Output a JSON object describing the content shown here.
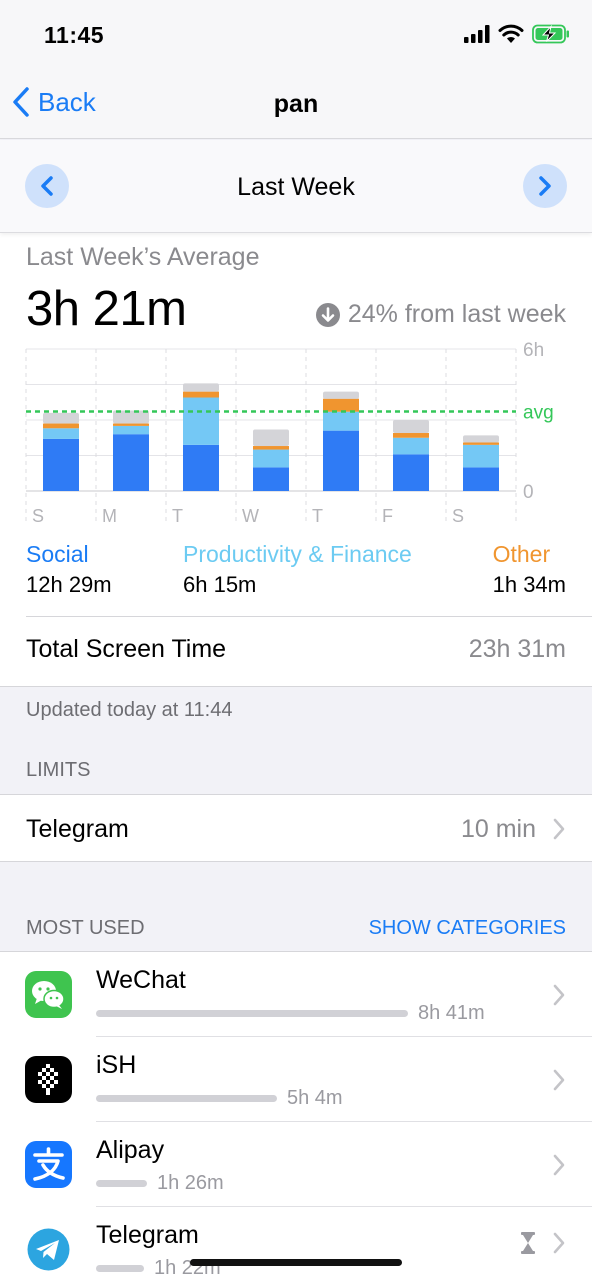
{
  "status_bar": {
    "time": "11:45"
  },
  "nav": {
    "back_label": "Back",
    "title": "pan"
  },
  "week_selector": {
    "label": "Last Week",
    "prev_icon": "chevron-left-icon",
    "next_icon": "chevron-right-icon"
  },
  "summary": {
    "avg_label": "Last Week’s Average",
    "avg_value": "3h 21m",
    "change_text": "24% from last week",
    "change_icon": "arrow-down-circle-icon"
  },
  "chart_data": {
    "type": "bar",
    "stacked": true,
    "categories": [
      "S",
      "M",
      "T",
      "W",
      "T",
      "F",
      "S"
    ],
    "y_ticks": [
      "6h",
      "0"
    ],
    "avg_label": "avg",
    "ylim_hours": [
      0,
      6
    ],
    "avg_hours": 3.36,
    "series": [
      {
        "color": "#2f7bf5",
        "values": [
          2.2,
          2.4,
          1.95,
          1.0,
          2.55,
          1.55,
          1.0
        ]
      },
      {
        "color": "#74c8f5",
        "values": [
          0.45,
          0.35,
          2.0,
          0.75,
          0.8,
          0.7,
          0.95
        ]
      },
      {
        "color": "#f0952f",
        "values": [
          0.2,
          0.1,
          0.25,
          0.15,
          0.55,
          0.2,
          0.1
        ]
      },
      {
        "color": "#d4d4d8",
        "values": [
          0.45,
          0.55,
          0.35,
          0.7,
          0.3,
          0.55,
          0.3
        ]
      }
    ]
  },
  "legend": [
    {
      "name": "Social",
      "value": "12h 29m",
      "color": "#1a7cf5"
    },
    {
      "name": "Productivity & Finance",
      "value": "6h 15m",
      "color": "#6ccbf2"
    },
    {
      "name": "Other",
      "value": "1h 34m",
      "color": "#f0952f"
    }
  ],
  "total": {
    "label": "Total Screen Time",
    "value": "23h 31m"
  },
  "updated_text": "Updated today at 11:44",
  "limits": {
    "header": "LIMITS",
    "app": "Telegram",
    "value": "10 min"
  },
  "most_used": {
    "header": "MOST USED",
    "show_categories": "SHOW CATEGORIES",
    "apps": [
      {
        "name": "WeChat",
        "time": "8h 41m",
        "icon": "wechat-icon",
        "share": 1.0
      },
      {
        "name": "iSH",
        "time": "5h 4m",
        "icon": "ish-icon",
        "share": 0.58
      },
      {
        "name": "Alipay",
        "time": "1h 26m",
        "icon": "alipay-icon",
        "share": 0.165
      },
      {
        "name": "Telegram",
        "time": "1h 22m",
        "icon": "telegram-icon",
        "share": 0.155
      }
    ]
  }
}
